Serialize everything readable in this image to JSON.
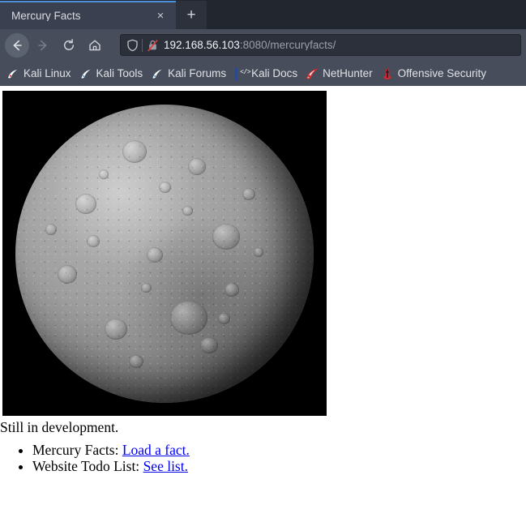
{
  "browser": {
    "tab": {
      "title": "Mercury Facts",
      "close_label": "×"
    },
    "new_tab_label": "+",
    "nav": {
      "back_label": "Back",
      "forward_label": "Forward",
      "reload_label": "Reload",
      "home_label": "Home"
    },
    "address": {
      "host": "192.168.56.103",
      "rest": ":8080/mercuryfacts/",
      "full_url": "192.168.56.103:8080/mercuryfacts/",
      "shield_icon": "shield-icon",
      "lock_icon": "lock-crossed-out-icon",
      "security": "Connection is not secure"
    },
    "bookmarks": [
      {
        "label": "Kali Linux",
        "icon": "kali-dragon-red-icon"
      },
      {
        "label": "Kali Tools",
        "icon": "kali-dragon-blue-icon"
      },
      {
        "label": "Kali Forums",
        "icon": "kali-dragon-blue-icon"
      },
      {
        "label": "Kali Docs",
        "icon": "red-book-code-icon"
      },
      {
        "label": "NetHunter",
        "icon": "kali-dragon-red-icon"
      },
      {
        "label": "Offensive Security",
        "icon": "red-dagger-icon"
      }
    ]
  },
  "page": {
    "hero_image_alt": "Mercury planet photograph",
    "status_text": "Still in development.",
    "items": [
      {
        "label": "Mercury Facts:",
        "link_text": "Load a fact."
      },
      {
        "label": "Website Todo List:",
        "link_text": "See list."
      }
    ]
  },
  "colors": {
    "tab_active_accent": "#4d90d8",
    "toolbar_bg": "#474d5a",
    "tabstrip_bg": "#22262e",
    "link": "#0000ee"
  }
}
